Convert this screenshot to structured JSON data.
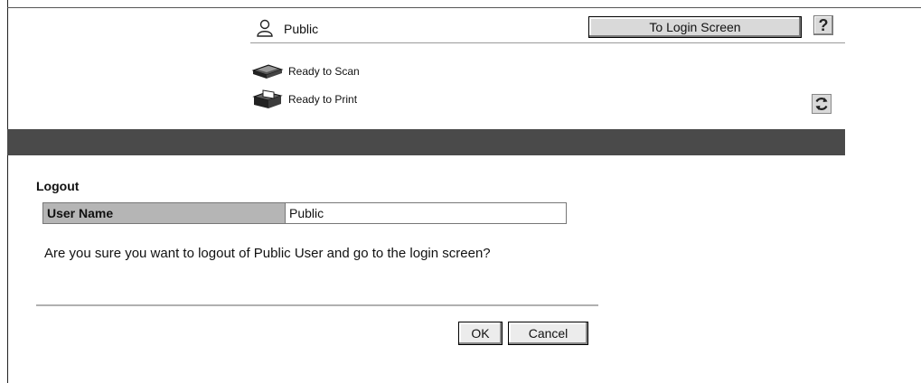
{
  "header": {
    "user": "Public",
    "login_button": "To Login Screen",
    "help_button": "?",
    "status": [
      {
        "label": "Ready to Scan",
        "icon": "scanner-icon"
      },
      {
        "label": "Ready to Print",
        "icon": "printer-icon"
      }
    ],
    "refresh_icon": "refresh-icon"
  },
  "logout": {
    "title": "Logout",
    "user_name_label": "User Name",
    "user_name_value": "Public",
    "message": "Are you sure you want to logout of Public User and go to the login screen?",
    "ok_button": "OK",
    "cancel_button": "Cancel"
  },
  "colors": {
    "band": "#4a4a4a",
    "table_header": "#b5b5b5",
    "button_face": "#d9d9d9"
  }
}
